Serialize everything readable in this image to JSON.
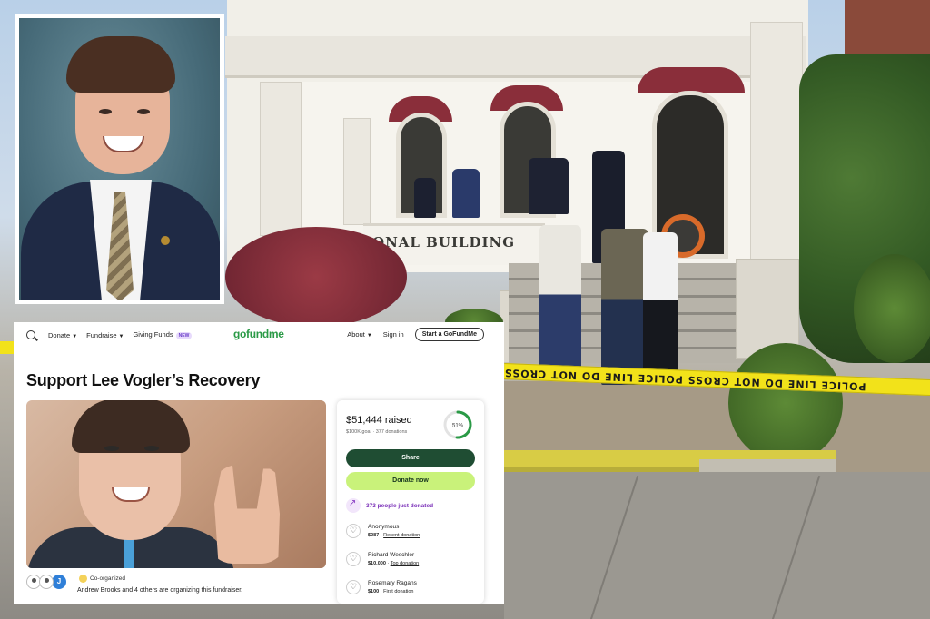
{
  "scene": {
    "building_sign": "ONAL BUILDING",
    "police_tape": "POLICE LINE DO NOT CROSS    POLICE LINE DO NOT CROSS"
  },
  "gofundme": {
    "nav": {
      "donate": "Donate",
      "fundraise": "Fundraise",
      "giving_funds": "Giving Funds",
      "new_badge": "NEW",
      "logo": "gofundme",
      "about": "About",
      "sign_in": "Sign in",
      "start": "Start a GoFundMe"
    },
    "title": "Support Lee Vogler’s Recovery",
    "organizers": {
      "avatar_letter": "J",
      "co_organized": "Co-organized",
      "text": "Andrew Brooks and 4 others are organizing this fundraiser."
    },
    "card": {
      "raised": "$51,444 raised",
      "goal": "$100K goal · 377 donations",
      "progress_label": "51%",
      "progress_fraction": 0.51,
      "share": "Share",
      "donate_now": "Donate now",
      "just_donated": "373 people just donated",
      "donations": [
        {
          "name": "Anonymous",
          "amount": "$287",
          "type": "Recent donation"
        },
        {
          "name": "Richard Weschler",
          "amount": "$10,000",
          "type": "Top donation"
        },
        {
          "name": "Rosemary Ragans",
          "amount": "$100",
          "type": "First donation"
        }
      ]
    },
    "colors": {
      "brand_green": "#2a9a46",
      "share_button": "#1f4d33",
      "donate_button": "#c9f27a",
      "trend_purple": "#7a2fb8"
    }
  }
}
